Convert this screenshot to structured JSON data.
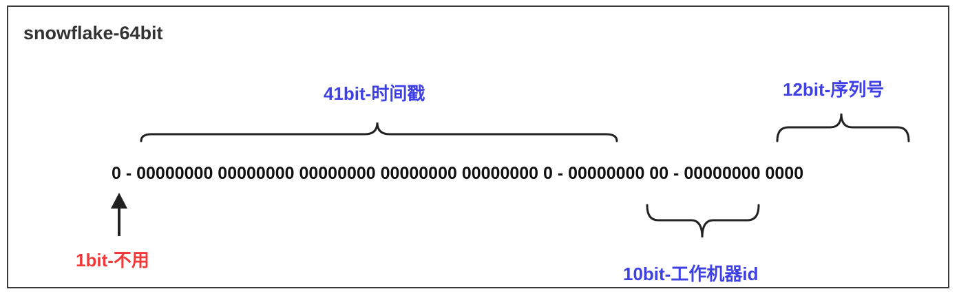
{
  "title": "snowflake-64bit",
  "bits_line": "0 - 00000000 00000000 00000000 00000000 00000000 0 - 00000000 00 - 00000000 0000",
  "segments": {
    "unused": {
      "label": "1bit-不用",
      "color": "#f03a3a"
    },
    "timestamp": {
      "label": "41bit-时间戳",
      "color": "#3f3fe6"
    },
    "worker": {
      "label": "10bit-工作机器id",
      "color": "#3f3fe6"
    },
    "sequence": {
      "label": "12bit-序列号",
      "color": "#3f3fe6"
    }
  }
}
